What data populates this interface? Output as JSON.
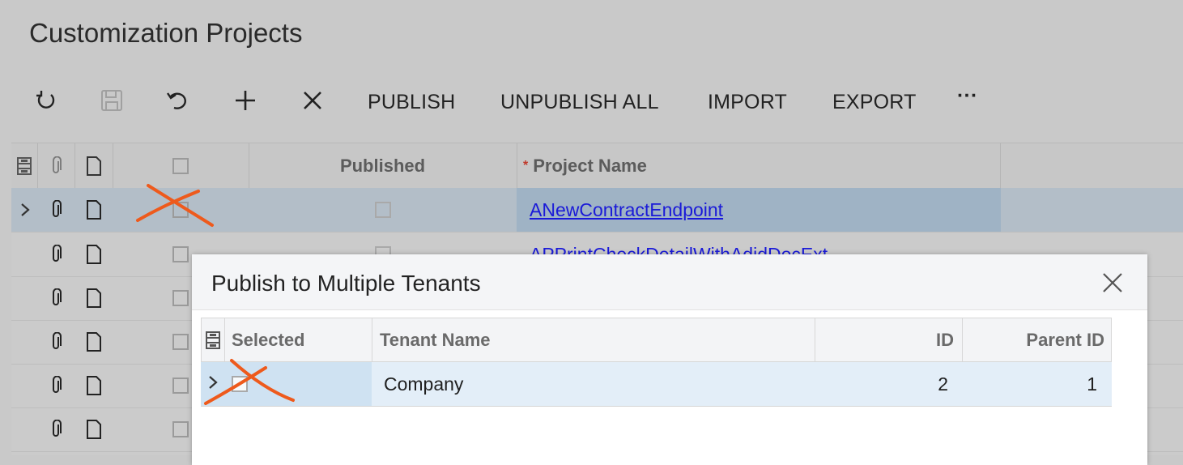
{
  "page": {
    "title": "Customization Projects"
  },
  "toolbar": {
    "refresh_icon": "refresh-icon",
    "save_icon": "save-icon",
    "undo_icon": "undo-icon",
    "add_icon": "plus-icon",
    "delete_icon": "close-icon",
    "publish_label": "PUBLISH",
    "unpublish_all_label": "UNPUBLISH ALL",
    "import_label": "IMPORT",
    "export_label": "EXPORT",
    "more_label": "···"
  },
  "grid": {
    "columns": {
      "published": "Published",
      "project_name": "Project Name",
      "required_marker": "*"
    },
    "rows": [
      {
        "project_name": "ANewContractEndpoint",
        "selected": true
      },
      {
        "project_name": "APPrintCheckDetailWithAdjdDocExt",
        "selected": false
      },
      {
        "project_name": "",
        "selected": false
      },
      {
        "project_name": "",
        "selected": false
      },
      {
        "project_name": "",
        "selected": false
      },
      {
        "project_name": "",
        "selected": false
      }
    ]
  },
  "dialog": {
    "title": "Publish to Multiple Tenants",
    "columns": {
      "selected": "Selected",
      "tenant_name": "Tenant Name",
      "id": "ID",
      "parent_id": "Parent ID"
    },
    "rows": [
      {
        "tenant_name": "Company",
        "id": "2",
        "parent_id": "1"
      }
    ]
  },
  "colors": {
    "annotation": "#ee5a1c",
    "link": "#1a1ad8",
    "selected_row": "#b3bec8"
  }
}
